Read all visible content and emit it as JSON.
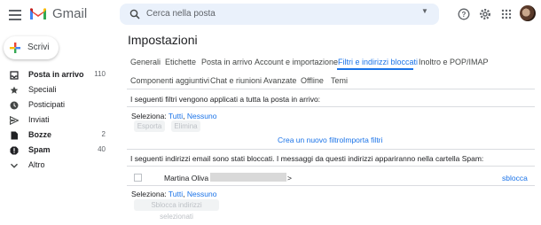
{
  "header": {
    "app_name": "Gmail",
    "search_placeholder": "Cerca nella posta"
  },
  "compose": {
    "label": "Scrivi"
  },
  "sidebar": {
    "items": [
      {
        "label": "Posta in arrivo",
        "count": "110",
        "icon": "inbox-icon",
        "bold": true
      },
      {
        "label": "Speciali",
        "count": "",
        "icon": "star-icon",
        "bold": false
      },
      {
        "label": "Posticipati",
        "count": "",
        "icon": "clock-icon",
        "bold": false
      },
      {
        "label": "Inviati",
        "count": "",
        "icon": "send-icon",
        "bold": false
      },
      {
        "label": "Bozze",
        "count": "2",
        "icon": "draft-icon",
        "bold": true
      },
      {
        "label": "Spam",
        "count": "40",
        "icon": "spam-icon",
        "bold": true
      },
      {
        "label": "Altro",
        "count": "",
        "icon": "chevron-down-icon",
        "bold": false
      }
    ]
  },
  "settings": {
    "title": "Impostazioni",
    "tabs_row1": [
      "Generali",
      "Etichette",
      "Posta in arrivo",
      "Account e importazione",
      "Filtri e indirizzi bloccati",
      "Inoltro e POP/IMAP"
    ],
    "tabs_row2": [
      "Componenti aggiuntivi",
      "Chat e riunioni",
      "Avanzate",
      "Offline",
      "Temi"
    ],
    "active_tab": "Filtri e indirizzi bloccati"
  },
  "filters": {
    "heading": "I seguenti filtri vengono applicati a tutta la posta in arrivo:",
    "select_label": "Seleziona:",
    "select_all": "Tutti",
    "select_none": "Nessuno",
    "export_button": "Esporta",
    "delete_button": "Elimina",
    "create_filter_link": "Crea un nuovo filtro",
    "import_filters_link": "Importa filtri"
  },
  "blocked": {
    "heading": "I seguenti indirizzi email sono stati bloccati. I messaggi da questi indirizzi appariranno nella cartella Spam:",
    "entries": [
      {
        "name": "Martina Oliva",
        "open": "<",
        "close": ">",
        "action": "sblocca"
      }
    ],
    "select_label": "Seleziona:",
    "select_all": "Tutti",
    "select_none": "Nessuno",
    "unblock_selected_button": "Sblocca indirizzi selezionati"
  },
  "colors": {
    "accent": "#1a73e8",
    "gmail_red": "#ea4335"
  }
}
